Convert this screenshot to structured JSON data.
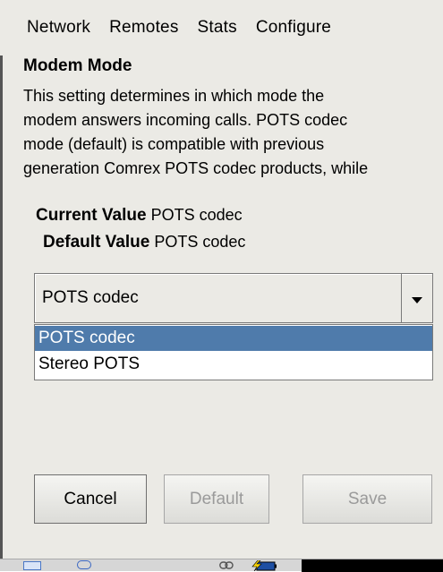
{
  "menubar": {
    "items": [
      "Network",
      "Remotes",
      "Stats",
      "Configure"
    ]
  },
  "setting": {
    "title": "Modem Mode",
    "description": [
      "This setting determines in which mode the",
      "modem answers incoming calls. POTS codec",
      "mode (default) is compatible with previous",
      "generation Comrex POTS codec products, while"
    ],
    "current_label": "Current Value",
    "current_value": "POTS codec",
    "default_label": "Default Value",
    "default_value": "POTS codec"
  },
  "select": {
    "selected": "POTS codec",
    "options": [
      "POTS codec",
      "Stereo POTS"
    ],
    "highlighted_index": 0
  },
  "buttons": {
    "cancel": "Cancel",
    "default": "Default",
    "save": "Save"
  },
  "taskbar": {
    "icons": [
      "keyboard-icon",
      "chat-icon",
      "link-icon",
      "battery-charging-icon"
    ]
  },
  "colors": {
    "highlight": "#4f7bab",
    "panel_bg": "#ebeae5",
    "disabled_text": "#9a9a9a"
  }
}
